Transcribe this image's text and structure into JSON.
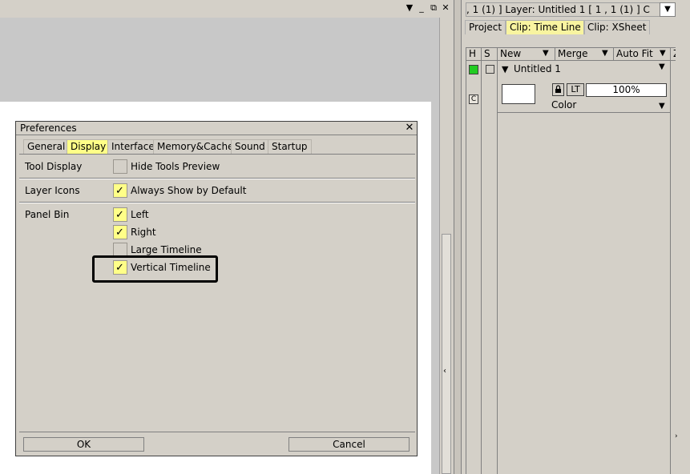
{
  "window_controls": [
    "▼",
    "_",
    "⧉",
    "✕"
  ],
  "panel": {
    "info_text": ", 1  (1) ]      Layer: Untitled 1 [ 1 , 1  (1) ]    C",
    "menu_icon": "▼",
    "tabs": [
      {
        "label": "Project",
        "active": false
      },
      {
        "label": "Clip: Time Line",
        "active": true
      },
      {
        "label": "Clip: XSheet",
        "active": false
      }
    ],
    "timeline": {
      "col_h": "H",
      "col_s": "S",
      "new_label": "New",
      "merge_label": "Merge",
      "autofit_label": "Auto Fit",
      "extra_label": "Z",
      "layer_name": "Untitled 1",
      "camera_badge": "C",
      "lock_icon": "lock-icon",
      "lt_label": "LT",
      "opacity": "100%",
      "blend_mode": "Color",
      "layer_color": "#22cc22"
    }
  },
  "prefs": {
    "title": "Preferences",
    "close": "✕",
    "tabs": [
      {
        "label": "General",
        "active": false
      },
      {
        "label": "Display",
        "active": true
      },
      {
        "label": "Interface",
        "active": false
      },
      {
        "label": "Memory&Cache",
        "active": false
      },
      {
        "label": "Sound",
        "active": false
      },
      {
        "label": "Startup",
        "active": false
      }
    ],
    "tool_display": {
      "label": "Tool Display",
      "options": [
        {
          "label": "Hide Tools Preview",
          "checked": false
        }
      ]
    },
    "layer_icons": {
      "label": "Layer Icons",
      "options": [
        {
          "label": "Always Show by Default",
          "checked": true
        }
      ]
    },
    "panel_bin": {
      "label": "Panel Bin",
      "options": [
        {
          "label": "Left",
          "checked": true
        },
        {
          "label": "Right",
          "checked": true
        },
        {
          "label": "Large Timeline",
          "checked": false
        },
        {
          "label": "Vertical Timeline",
          "checked": true
        }
      ]
    },
    "ok_label": "OK",
    "cancel_label": "Cancel",
    "check_glyph": "✓",
    "accent_color": "#ffff88"
  }
}
